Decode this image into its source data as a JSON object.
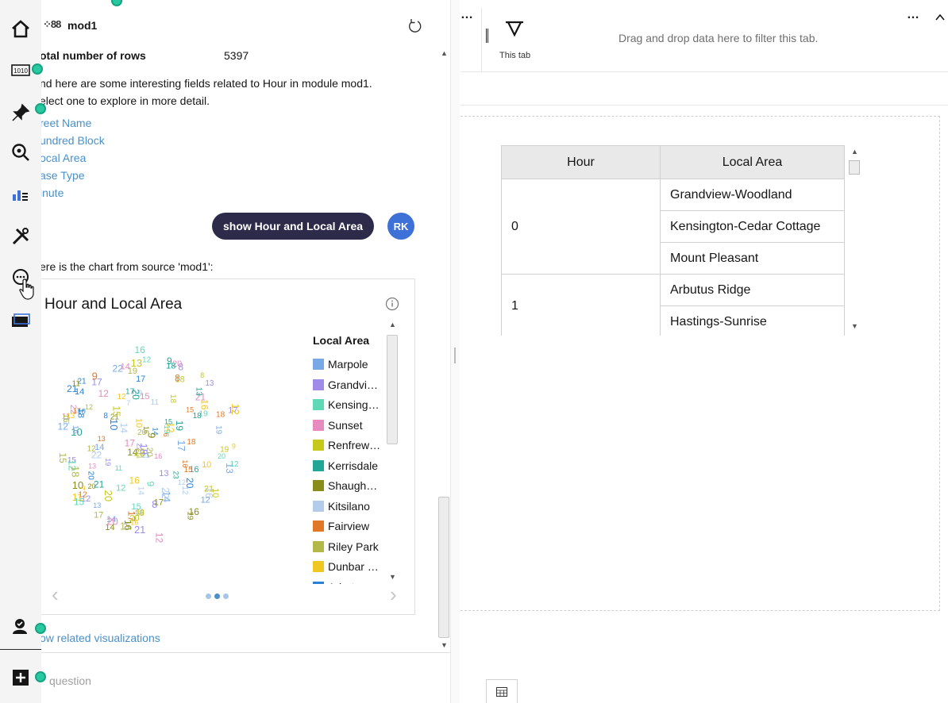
{
  "panel": {
    "title": "mod1",
    "stat": {
      "label": "otal number of rows",
      "value": "5397"
    },
    "msg1": "nd here are some interesting fields related to Hour in module mod1.",
    "msg2": "elect one to explore in more detail.",
    "fields": [
      "reet Name",
      "undred Block",
      "ocal Area",
      "ase Type",
      "inute"
    ],
    "user_query": "show Hour and Local Area",
    "user_initials": "RK",
    "chart_intro": "ere is the chart from source 'mod1':",
    "related": "ow related visualizations",
    "ask_placeholder": "question"
  },
  "card": {
    "title": "Hour and Local Area",
    "legend_title": "Local Area",
    "legend": [
      {
        "label": "Marpole",
        "color": "#78a9e6"
      },
      {
        "label": "Grandvi…",
        "color": "#9e8ce8"
      },
      {
        "label": "Kensing…",
        "color": "#5fd8b6"
      },
      {
        "label": "Sunset",
        "color": "#e68ac0"
      },
      {
        "label": "Renfrew…",
        "color": "#c6c81c"
      },
      {
        "label": "Kerrisdale",
        "color": "#22a695"
      },
      {
        "label": "Shaugh…",
        "color": "#8a8c1a"
      },
      {
        "label": "Kitsilano",
        "color": "#b3cceb"
      },
      {
        "label": "Fairview",
        "color": "#e07828"
      },
      {
        "label": "Riley Park",
        "color": "#b3b84a"
      },
      {
        "label": "Dunbar …",
        "color": "#f0c722"
      },
      {
        "label": "Arbutus …",
        "color": "#2a82d6"
      }
    ],
    "cloud_numbers": [
      "21",
      "22",
      "19",
      "20",
      "18",
      "10",
      "14",
      "19",
      "12",
      "17",
      "12",
      "14",
      "12",
      "17",
      "15",
      "12",
      "20",
      "16",
      "21",
      "12",
      "6",
      "18",
      "11",
      "20",
      "13",
      "8",
      "12",
      "11",
      "8",
      "18",
      "16",
      "14",
      "15",
      "12",
      "10",
      "14",
      "17",
      "21",
      "9",
      "12",
      "13",
      "19",
      "9",
      "11",
      "8",
      "12",
      "9",
      "20",
      "14",
      "13",
      "20",
      "15",
      "23",
      "17",
      "10",
      "11",
      "18",
      "15",
      "7",
      "8",
      "13",
      "19",
      "12",
      "16",
      "21",
      "15",
      "16",
      "22",
      "18",
      "16",
      "10",
      "17",
      "14",
      "13",
      "16",
      "22",
      "10",
      "9",
      "14",
      "12",
      "17",
      "20",
      "13",
      "10",
      "16",
      "18",
      "12",
      "21",
      "13",
      "20",
      "20",
      "7",
      "15",
      "11",
      "16",
      "10",
      "19",
      "12",
      "11",
      "14",
      "18",
      "21",
      "16",
      "22",
      "13",
      "15",
      "12",
      "18",
      "14",
      "17",
      "19",
      "20",
      "15",
      "13",
      "17",
      "16",
      "16",
      "20",
      "12",
      "21",
      "22",
      "15",
      "12",
      "17",
      "19",
      "23",
      "19",
      "22",
      "17",
      "18",
      "16",
      "21",
      "12",
      "8",
      "15",
      "13",
      "20",
      "18",
      "11",
      "14",
      "9",
      "19",
      "16"
    ]
  },
  "tab": {
    "filter_label": "This tab",
    "filter_hint": "Drag and drop data here to filter this tab.",
    "more": "…"
  },
  "table": {
    "headers": [
      "Hour",
      "Local Area"
    ],
    "groups": [
      {
        "hour": "0",
        "areas": [
          "Grandview-Woodland",
          "Kensington-Cedar Cottage",
          "Mount Pleasant"
        ]
      },
      {
        "hour": "1",
        "areas": [
          "Arbutus Ridge",
          "Hastings-Sunrise"
        ]
      }
    ]
  }
}
